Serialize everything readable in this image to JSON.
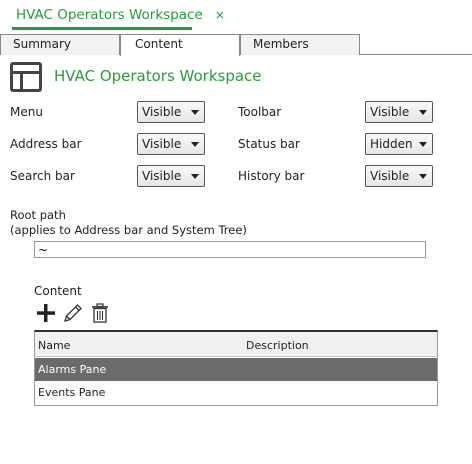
{
  "document_tab": {
    "title": "HVAC Operators Workspace",
    "close": "×"
  },
  "tabs": [
    {
      "label": "Summary"
    },
    {
      "label": "Content"
    },
    {
      "label": "Members"
    }
  ],
  "header": {
    "icon": "workspace-layout-icon",
    "title": "HVAC Operators Workspace"
  },
  "settings": {
    "menu": {
      "label": "Menu",
      "value": "Visible"
    },
    "toolbar": {
      "label": "Toolbar",
      "value": "Visible"
    },
    "address_bar": {
      "label": "Address bar",
      "value": "Visible"
    },
    "status_bar": {
      "label": "Status bar",
      "value": "Hidden"
    },
    "search_bar": {
      "label": "Search bar",
      "value": "Visible"
    },
    "history_bar": {
      "label": "History bar",
      "value": "Visible"
    }
  },
  "root_path": {
    "label_line1": "Root path",
    "label_line2": "(applies to Address bar and System Tree)",
    "value": "~"
  },
  "content": {
    "label": "Content",
    "tools": [
      "add-icon",
      "edit-pencil-icon",
      "delete-trash-icon"
    ],
    "columns": [
      "Name",
      "Description"
    ],
    "rows": [
      {
        "name": "Alarms Pane",
        "description": "",
        "selected": true
      },
      {
        "name": "Events Pane",
        "description": "",
        "selected": false
      }
    ]
  },
  "colors": {
    "accent": "#2b9a3e",
    "selected_row": "#6b6b6b"
  }
}
